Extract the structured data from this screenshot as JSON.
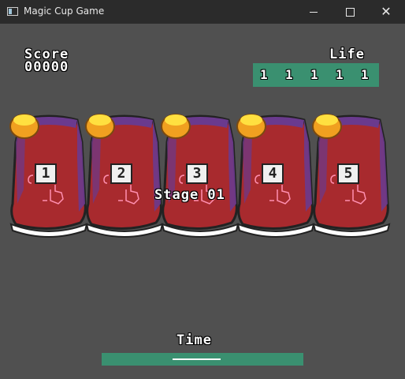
{
  "window": {
    "title": "Magic Cup Game",
    "controls": {
      "minimize": "minimize",
      "maximize": "maximize",
      "close": "✕"
    }
  },
  "hud": {
    "score_label": "Score",
    "score_value": "00000",
    "life_label": "Life",
    "life_values": [
      "1",
      "1",
      "1",
      "1",
      "1"
    ],
    "stage_text": "Stage 01",
    "time_label": "Time",
    "time_remaining_fraction": 0.25
  },
  "cups": [
    {
      "number": "1"
    },
    {
      "number": "2"
    },
    {
      "number": "3"
    },
    {
      "number": "4"
    },
    {
      "number": "5"
    }
  ],
  "colors": {
    "background": "#505050",
    "titlebar": "#2b2b2b",
    "hud_panel": "#3a9070",
    "cup_red": "#a82a2e",
    "cup_purple": "#6a3a8e",
    "ball_orange": "#f0a020",
    "ball_yellow": "#ffe040"
  },
  "icons": {
    "app": "window-app-icon",
    "cup_decal": "hand-pointer-icon",
    "ball": "gold-ball-icon"
  }
}
